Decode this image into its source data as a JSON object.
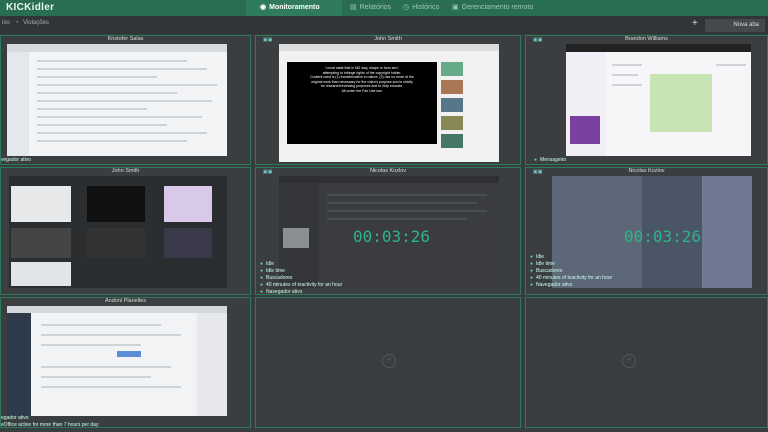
{
  "app": {
    "logo": "KICKidler"
  },
  "tabs": [
    {
      "label": "Monitoramento",
      "active": true
    },
    {
      "label": "Relatórios",
      "active": false
    },
    {
      "label": "Histórico",
      "active": false
    },
    {
      "label": "Gerenciamento remoto",
      "active": false
    }
  ],
  "subbar": {
    "left_label": "ixo",
    "violations_label": "Violações",
    "new_label": "Nova aba"
  },
  "tiles": [
    {
      "name": "Kristofer Salas",
      "status": [
        "vegador ativo"
      ]
    },
    {
      "name": "John Smith",
      "status": []
    },
    {
      "name": "Brandon Williams",
      "status": [
        "Mensageiro"
      ]
    },
    {
      "name": "John Smith",
      "status": []
    },
    {
      "name": "Nicolas Kozlov",
      "timer": "00:03:26",
      "status": [
        "Idle",
        "Idle time",
        "Buscadores",
        "40 minutes of inactivity for an hour",
        "Navegador ativo"
      ]
    },
    {
      "name": "Nicolas Kozlov",
      "timer": "00:03:26",
      "status": [
        "Idle",
        "Idle time",
        "Buscadores",
        "40 minutes of inactivity for an hour",
        "Navegador ativo"
      ]
    },
    {
      "name": "Andoni Planelles",
      "status": [
        "egador ativo",
        "eOffice active for more than 7 hours per day"
      ]
    }
  ],
  "video_text": {
    "lines": [
      "I must state that in NO way, shape or form am I",
      "attempting to infringe rights of the copyright holder.",
      "",
      "Content used is (1) transformative in nature, (3) use no more of the",
      "original work than necessary for the video's purpose and is strictly",
      "for research/reviewing purposes and to help educate.",
      "All under the Fair Use law."
    ]
  },
  "colors": {
    "accent": "#2a6e52",
    "timer": "#2fb389",
    "tile_border": "#2c7a5a"
  }
}
